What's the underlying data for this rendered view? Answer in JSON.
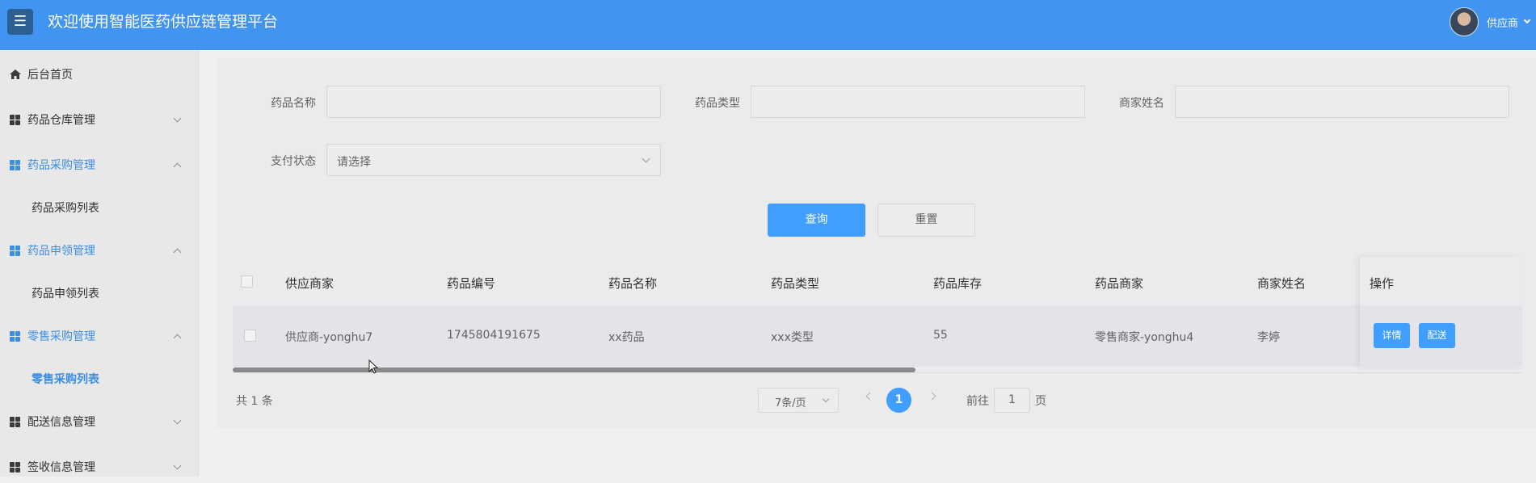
{
  "header": {
    "title": "欢迎使用智能医药供应链管理平台",
    "menu_icon": "☰",
    "user_label": "供应商",
    "colors": {
      "header_bg": "#4195f0",
      "accent": "#409eff"
    }
  },
  "sidebar": {
    "home": "后台首页",
    "groups": [
      {
        "label": "药品仓库管理",
        "expanded": false
      },
      {
        "label": "药品采购管理",
        "expanded": true,
        "children": [
          "药品采购列表"
        ]
      },
      {
        "label": "药品申领管理",
        "expanded": true,
        "children": [
          "药品申领列表"
        ]
      },
      {
        "label": "零售采购管理",
        "expanded": true,
        "children": [
          "零售采购列表"
        ],
        "active_child": "零售采购列表"
      },
      {
        "label": "配送信息管理",
        "expanded": false
      },
      {
        "label": "签收信息管理",
        "expanded": false
      }
    ]
  },
  "filters": {
    "drug_name_label": "药品名称",
    "drug_name_value": "",
    "drug_type_label": "药品类型",
    "drug_type_value": "",
    "merchant_name_label": "商家姓名",
    "merchant_name_value": "",
    "pay_status_label": "支付状态",
    "pay_status_placeholder": "请选择"
  },
  "actions": {
    "query": "查询",
    "reset": "重置"
  },
  "table": {
    "columns": [
      "供应商家",
      "药品编号",
      "药品名称",
      "药品类型",
      "药品库存",
      "药品商家",
      "商家姓名",
      "操作"
    ],
    "rows": [
      {
        "supplier": "供应商-yonghu7",
        "drug_code": "1745804191675",
        "drug_name": "xx药品",
        "drug_type": "xxx类型",
        "stock": "55",
        "merchant": "零售商家-yonghu4",
        "merchant_name": "李婷",
        "btn_detail": "详情",
        "btn_deliver": "配送"
      }
    ]
  },
  "pagination": {
    "total": "共 1 条",
    "page_size": "7条/页",
    "current_page": "1",
    "goto_label": "前往",
    "goto_value": "1",
    "goto_suffix": "页"
  }
}
